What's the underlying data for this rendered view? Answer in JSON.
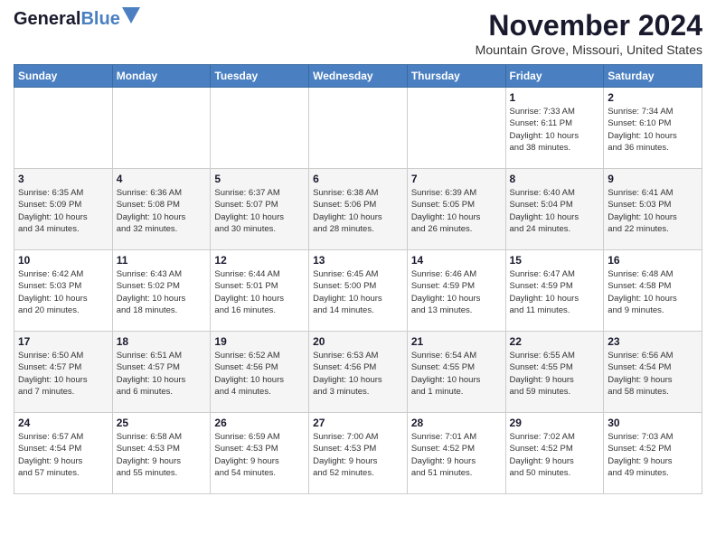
{
  "logo": {
    "line1": "General",
    "line2": "Blue"
  },
  "title": "November 2024",
  "location": "Mountain Grove, Missouri, United States",
  "days_of_week": [
    "Sunday",
    "Monday",
    "Tuesday",
    "Wednesday",
    "Thursday",
    "Friday",
    "Saturday"
  ],
  "weeks": [
    [
      {
        "day": "",
        "info": ""
      },
      {
        "day": "",
        "info": ""
      },
      {
        "day": "",
        "info": ""
      },
      {
        "day": "",
        "info": ""
      },
      {
        "day": "",
        "info": ""
      },
      {
        "day": "1",
        "info": "Sunrise: 7:33 AM\nSunset: 6:11 PM\nDaylight: 10 hours\nand 38 minutes."
      },
      {
        "day": "2",
        "info": "Sunrise: 7:34 AM\nSunset: 6:10 PM\nDaylight: 10 hours\nand 36 minutes."
      }
    ],
    [
      {
        "day": "3",
        "info": "Sunrise: 6:35 AM\nSunset: 5:09 PM\nDaylight: 10 hours\nand 34 minutes."
      },
      {
        "day": "4",
        "info": "Sunrise: 6:36 AM\nSunset: 5:08 PM\nDaylight: 10 hours\nand 32 minutes."
      },
      {
        "day": "5",
        "info": "Sunrise: 6:37 AM\nSunset: 5:07 PM\nDaylight: 10 hours\nand 30 minutes."
      },
      {
        "day": "6",
        "info": "Sunrise: 6:38 AM\nSunset: 5:06 PM\nDaylight: 10 hours\nand 28 minutes."
      },
      {
        "day": "7",
        "info": "Sunrise: 6:39 AM\nSunset: 5:05 PM\nDaylight: 10 hours\nand 26 minutes."
      },
      {
        "day": "8",
        "info": "Sunrise: 6:40 AM\nSunset: 5:04 PM\nDaylight: 10 hours\nand 24 minutes."
      },
      {
        "day": "9",
        "info": "Sunrise: 6:41 AM\nSunset: 5:03 PM\nDaylight: 10 hours\nand 22 minutes."
      }
    ],
    [
      {
        "day": "10",
        "info": "Sunrise: 6:42 AM\nSunset: 5:03 PM\nDaylight: 10 hours\nand 20 minutes."
      },
      {
        "day": "11",
        "info": "Sunrise: 6:43 AM\nSunset: 5:02 PM\nDaylight: 10 hours\nand 18 minutes."
      },
      {
        "day": "12",
        "info": "Sunrise: 6:44 AM\nSunset: 5:01 PM\nDaylight: 10 hours\nand 16 minutes."
      },
      {
        "day": "13",
        "info": "Sunrise: 6:45 AM\nSunset: 5:00 PM\nDaylight: 10 hours\nand 14 minutes."
      },
      {
        "day": "14",
        "info": "Sunrise: 6:46 AM\nSunset: 4:59 PM\nDaylight: 10 hours\nand 13 minutes."
      },
      {
        "day": "15",
        "info": "Sunrise: 6:47 AM\nSunset: 4:59 PM\nDaylight: 10 hours\nand 11 minutes."
      },
      {
        "day": "16",
        "info": "Sunrise: 6:48 AM\nSunset: 4:58 PM\nDaylight: 10 hours\nand 9 minutes."
      }
    ],
    [
      {
        "day": "17",
        "info": "Sunrise: 6:50 AM\nSunset: 4:57 PM\nDaylight: 10 hours\nand 7 minutes."
      },
      {
        "day": "18",
        "info": "Sunrise: 6:51 AM\nSunset: 4:57 PM\nDaylight: 10 hours\nand 6 minutes."
      },
      {
        "day": "19",
        "info": "Sunrise: 6:52 AM\nSunset: 4:56 PM\nDaylight: 10 hours\nand 4 minutes."
      },
      {
        "day": "20",
        "info": "Sunrise: 6:53 AM\nSunset: 4:56 PM\nDaylight: 10 hours\nand 3 minutes."
      },
      {
        "day": "21",
        "info": "Sunrise: 6:54 AM\nSunset: 4:55 PM\nDaylight: 10 hours\nand 1 minute."
      },
      {
        "day": "22",
        "info": "Sunrise: 6:55 AM\nSunset: 4:55 PM\nDaylight: 9 hours\nand 59 minutes."
      },
      {
        "day": "23",
        "info": "Sunrise: 6:56 AM\nSunset: 4:54 PM\nDaylight: 9 hours\nand 58 minutes."
      }
    ],
    [
      {
        "day": "24",
        "info": "Sunrise: 6:57 AM\nSunset: 4:54 PM\nDaylight: 9 hours\nand 57 minutes."
      },
      {
        "day": "25",
        "info": "Sunrise: 6:58 AM\nSunset: 4:53 PM\nDaylight: 9 hours\nand 55 minutes."
      },
      {
        "day": "26",
        "info": "Sunrise: 6:59 AM\nSunset: 4:53 PM\nDaylight: 9 hours\nand 54 minutes."
      },
      {
        "day": "27",
        "info": "Sunrise: 7:00 AM\nSunset: 4:53 PM\nDaylight: 9 hours\nand 52 minutes."
      },
      {
        "day": "28",
        "info": "Sunrise: 7:01 AM\nSunset: 4:52 PM\nDaylight: 9 hours\nand 51 minutes."
      },
      {
        "day": "29",
        "info": "Sunrise: 7:02 AM\nSunset: 4:52 PM\nDaylight: 9 hours\nand 50 minutes."
      },
      {
        "day": "30",
        "info": "Sunrise: 7:03 AM\nSunset: 4:52 PM\nDaylight: 9 hours\nand 49 minutes."
      }
    ]
  ]
}
